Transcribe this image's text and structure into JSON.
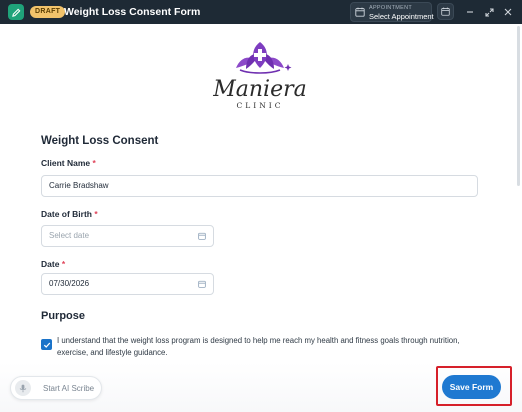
{
  "titlebar": {
    "badge": "DRAFT",
    "title": "Weight Loss Consent Form",
    "appointment_label": "APPOINTMENT",
    "appointment_value": "Select Appointment"
  },
  "logo": {
    "name": "Maniera",
    "subtitle": "CLINIC"
  },
  "form": {
    "section_title": "Weight Loss Consent",
    "client_name": {
      "label": "Client Name",
      "required": "*",
      "value": "Carrie Bradshaw"
    },
    "dob": {
      "label": "Date of Birth",
      "required": "*",
      "placeholder": "Select date"
    },
    "date": {
      "label": "Date",
      "required": "*",
      "value": "07/30/2026"
    },
    "purpose_title": "Purpose",
    "purpose_consent": "I understand that the weight loss program is designed to help me reach my health and fitness goals through nutrition, exercise, and lifestyle guidance.",
    "purpose_checked": true
  },
  "bottom": {
    "scribe_label": "Start AI Scribe",
    "save_label": "Save Form"
  },
  "colors": {
    "titlebar": "#1e2a35",
    "accent": "#1f79d1",
    "draft": "#f2c36b",
    "highlight": "#d6202a",
    "logo_purple": "#7b3fbf"
  }
}
